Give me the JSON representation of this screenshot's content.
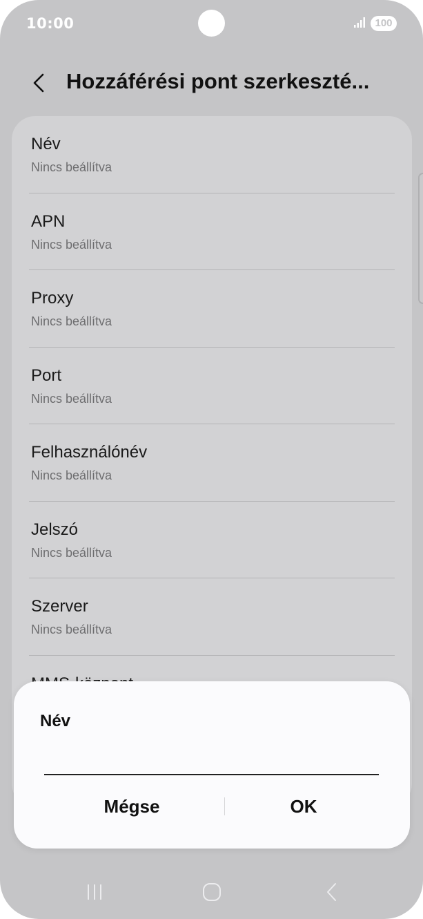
{
  "status_bar": {
    "time": "10:00",
    "battery": "100"
  },
  "header": {
    "title": "Hozzáférési pont szerkeszté..."
  },
  "list": {
    "items": [
      {
        "title": "Név",
        "value": "Nincs beállítva"
      },
      {
        "title": "APN",
        "value": "Nincs beállítva"
      },
      {
        "title": "Proxy",
        "value": "Nincs beállítva"
      },
      {
        "title": "Port",
        "value": "Nincs beállítva"
      },
      {
        "title": "Felhasználónév",
        "value": "Nincs beállítva"
      },
      {
        "title": "Jelszó",
        "value": "Nincs beállítva"
      },
      {
        "title": "Szerver",
        "value": "Nincs beállítva"
      },
      {
        "title": "MMS-központ",
        "value": ""
      }
    ]
  },
  "dialog": {
    "title": "Név",
    "input_value": "",
    "cancel_label": "Mégse",
    "ok_label": "OK"
  },
  "icons": {
    "back": "chevron-left-icon",
    "signal": "signal-icon",
    "nav_recents": "recents-icon",
    "nav_home": "home-icon",
    "nav_back": "back-icon"
  },
  "colors": {
    "background": "#c5c5c7",
    "list_card": "#d2d2d4",
    "dialog": "#fbfbfd",
    "text": "#111111",
    "secondary_text": "#6e6e70"
  }
}
